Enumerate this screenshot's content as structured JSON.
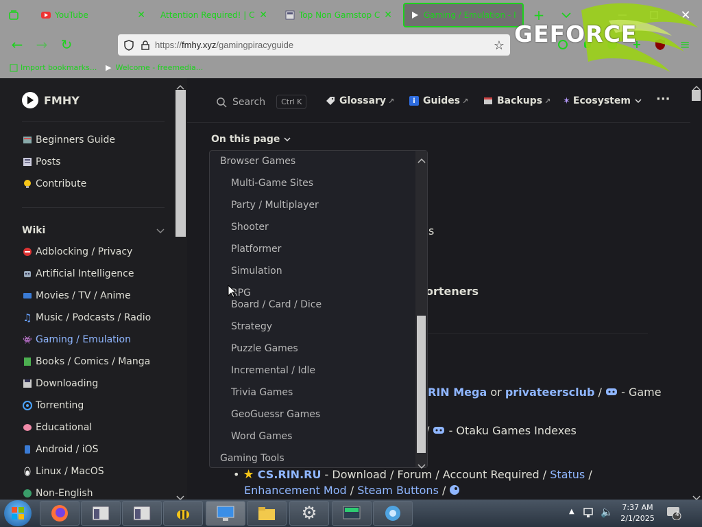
{
  "browser": {
    "tabs": [
      {
        "title": "YouTube",
        "favicon": "youtube-icon"
      },
      {
        "title": "Attention Required! | Cloud",
        "favicon": "none"
      },
      {
        "title": "Top Non Gamstop Casi",
        "favicon": "page-icon"
      },
      {
        "title": "Gaming / Emulation - I",
        "favicon": "fmhy-icon",
        "active": true
      }
    ],
    "url_prefix": "https://",
    "url_host": "fmhy.xyz",
    "url_path": "/gamingpiracyguide",
    "bookmarks": [
      "Import bookmarks...",
      "Welcome - freemedia..."
    ],
    "overlay_text": "GEFORCE",
    "accent_color": "#1ed21e"
  },
  "site": {
    "logo": "FMHY",
    "search_label": "Search",
    "search_shortcut": "Ctrl K",
    "nav": [
      {
        "label": "Glossary",
        "suffix": "↗"
      },
      {
        "label": "Guides",
        "suffix": "↗"
      },
      {
        "label": "Backups",
        "suffix": "↗"
      },
      {
        "label": "Ecosystem",
        "suffix": "⌄"
      }
    ],
    "more": "···"
  },
  "sidebar": {
    "top_items": [
      {
        "label": "Beginners Guide",
        "icon": "book-icon"
      },
      {
        "label": "Posts",
        "icon": "newspaper-icon"
      },
      {
        "label": "Contribute",
        "icon": "lightbulb-icon"
      }
    ],
    "wiki_title": "Wiki",
    "wiki_items": [
      {
        "label": "Adblocking / Privacy",
        "icon": "no-entry-icon"
      },
      {
        "label": "Artificial Intelligence",
        "icon": "robot-icon"
      },
      {
        "label": "Movies / TV / Anime",
        "icon": "tv-icon"
      },
      {
        "label": "Music / Podcasts / Radio",
        "icon": "music-icon"
      },
      {
        "label": "Gaming / Emulation",
        "icon": "gamepad-icon",
        "active": true
      },
      {
        "label": "Books / Comics / Manga",
        "icon": "book-green-icon"
      },
      {
        "label": "Downloading",
        "icon": "floppy-icon"
      },
      {
        "label": "Torrenting",
        "icon": "torrent-icon"
      },
      {
        "label": "Educational",
        "icon": "brain-icon"
      },
      {
        "label": "Android / iOS",
        "icon": "phone-icon"
      },
      {
        "label": "Linux / MacOS",
        "icon": "penguin-icon"
      },
      {
        "label": "Non-English",
        "icon": "globe-icon"
      }
    ]
  },
  "toc": {
    "toggle_label": "On this page",
    "items": [
      {
        "label": "Browser Games",
        "level": 1
      },
      {
        "label": "Multi-Game Sites",
        "level": 2
      },
      {
        "label": "Party / Multiplayer",
        "level": 2
      },
      {
        "label": "Shooter",
        "level": 2
      },
      {
        "label": "Platformer",
        "level": 2
      },
      {
        "label": "Simulation",
        "level": 2
      },
      {
        "label": "RPG",
        "level": 2
      },
      {
        "label": "Board / Card / Dice",
        "level": 2
      },
      {
        "label": "Strategy",
        "level": 2
      },
      {
        "label": "Puzzle Games",
        "level": 2
      },
      {
        "label": "Incremental / Idle",
        "level": 2
      },
      {
        "label": "Trivia Games",
        "level": 2
      },
      {
        "label": "GeoGuessr Games",
        "level": 2
      },
      {
        "label": "Word Games",
        "level": 2
      },
      {
        "label": "Gaming Tools",
        "level": 1
      }
    ]
  },
  "content": {
    "frag_s": "s",
    "frag_shorteners": "orteners",
    "line1": {
      "link1": "RIN Mega",
      "or": " or ",
      "link2": "privateersclub",
      "sep": " / ",
      "tail": " - Game"
    },
    "line2": {
      "lead": "/",
      "tail": " - Otaku Games Indexes"
    },
    "line3": {
      "link1": "CS.RIN.RU",
      "text1": " - Download / Forum / Account Required / ",
      "link2": "Status",
      "text2": " /"
    },
    "line4": {
      "link1": "Enhancement Mod",
      "sep": " / ",
      "link2": "Steam Buttons",
      "sep2": " /"
    }
  },
  "taskbar": {
    "time": "7:37 AM",
    "date": "2/1/2025",
    "notification_count": "4"
  }
}
